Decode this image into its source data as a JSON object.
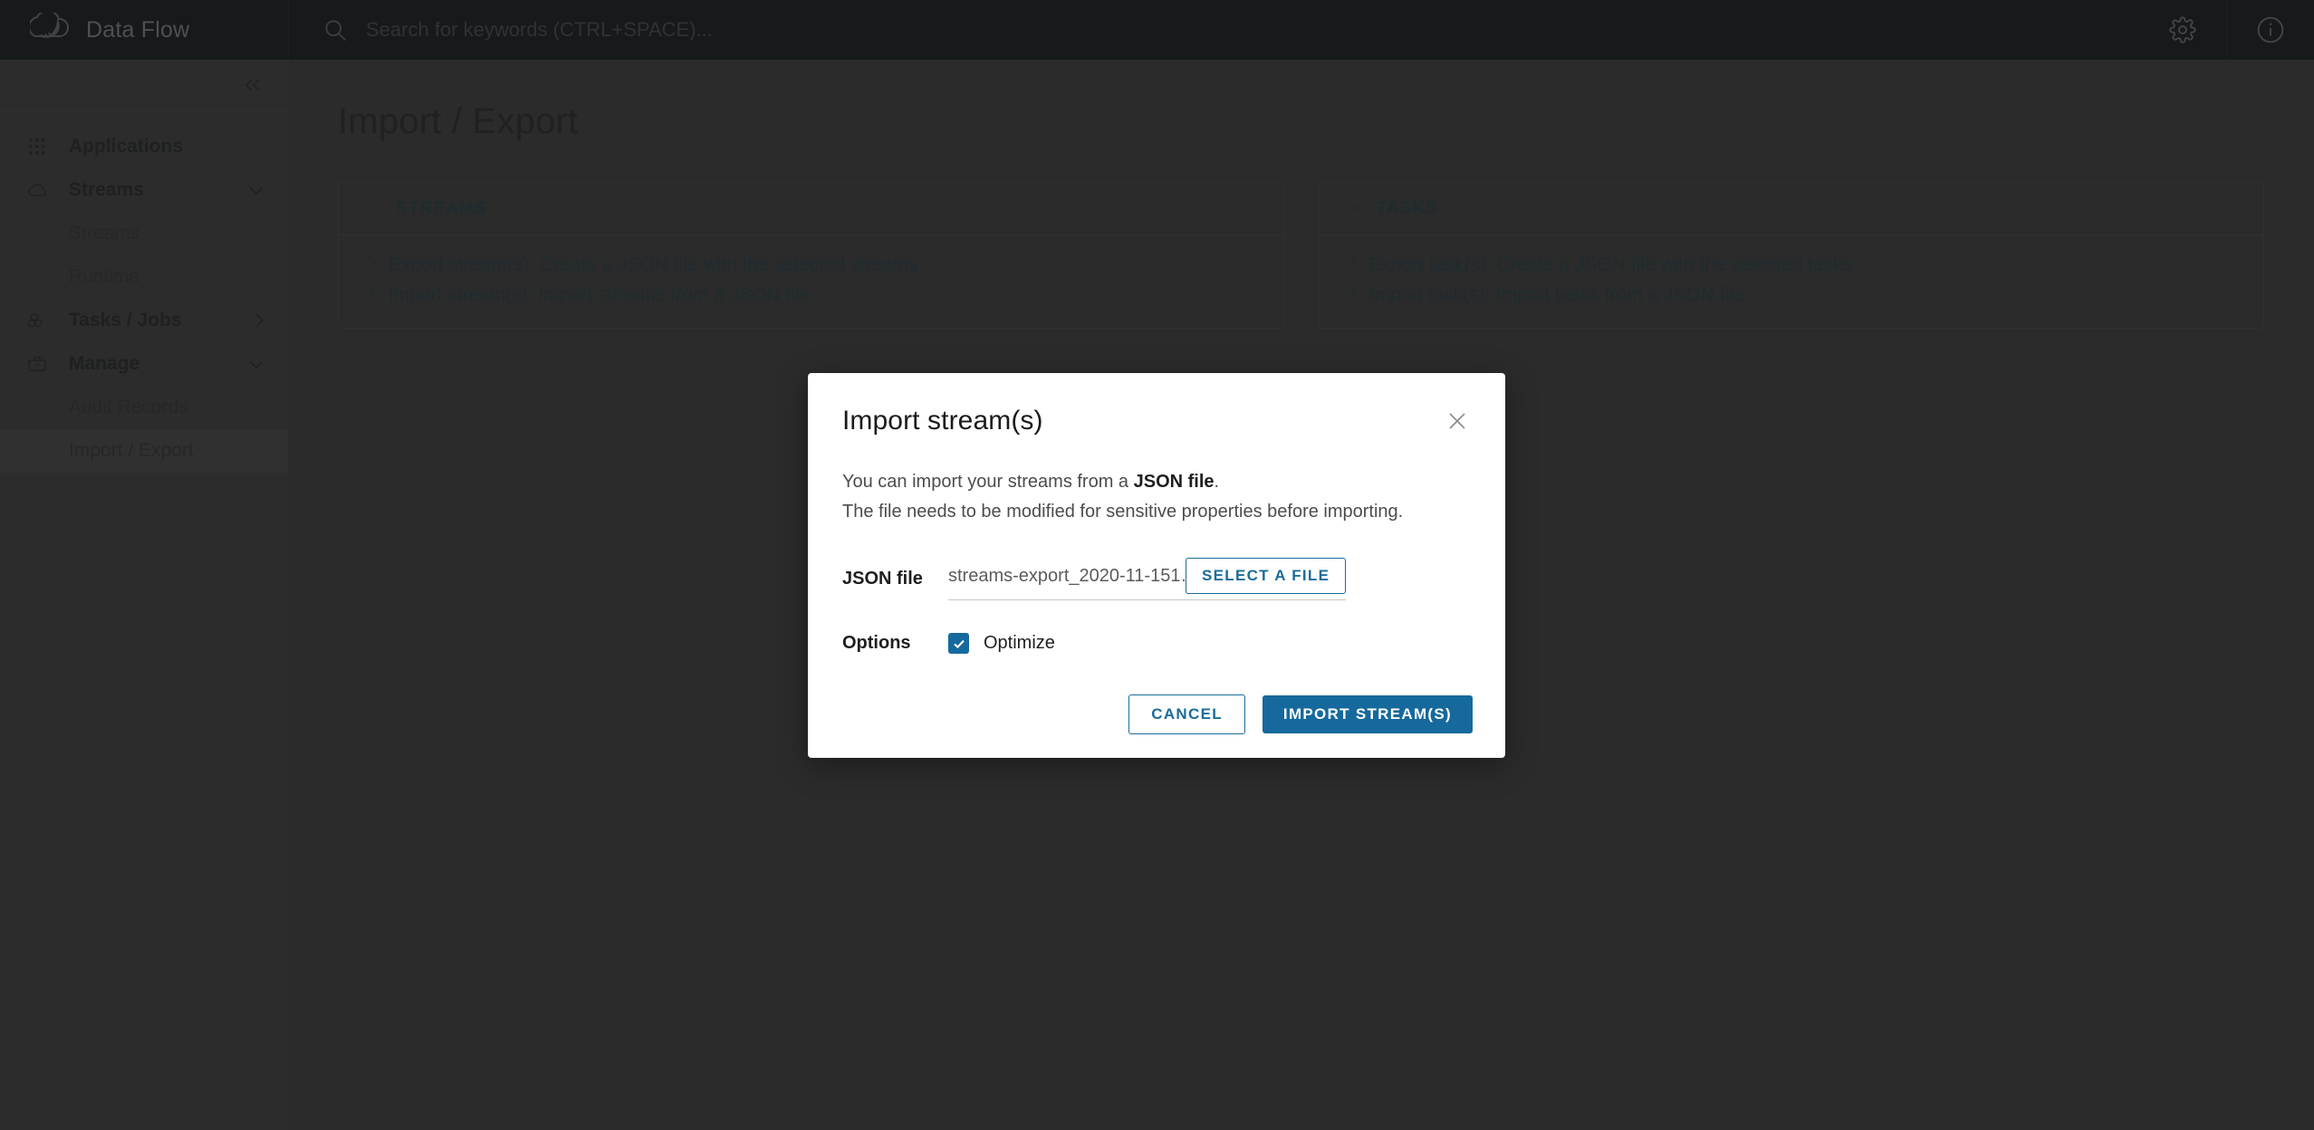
{
  "header": {
    "brand_title": "Data Flow",
    "logo_icon": "spring-cloud-leaf-logo",
    "search": {
      "icon": "search-icon",
      "placeholder": "Search for keywords (CTRL+SPACE)...",
      "value": ""
    },
    "settings_icon": "gear-icon",
    "about_icon": "info-circle-icon"
  },
  "sidebar": {
    "collapse_icon": "double-chevron-left-icon",
    "items": [
      {
        "label": "Applications",
        "icon": "grid-apps-icon",
        "type": "group",
        "chevron": "none",
        "active": false
      },
      {
        "label": "Streams",
        "icon": "cloud-icon",
        "type": "group",
        "chevron": "chevron-down-icon",
        "active": false
      },
      {
        "label": "Streams",
        "icon": "none",
        "type": "sub",
        "chevron": "none",
        "active": false
      },
      {
        "label": "Runtime",
        "icon": "none",
        "type": "sub",
        "chevron": "none",
        "active": false
      },
      {
        "label": "Tasks / Jobs",
        "icon": "cubes-icon",
        "type": "group",
        "chevron": "chevron-right-icon",
        "active": false
      },
      {
        "label": "Manage",
        "icon": "briefcase-icon",
        "type": "group",
        "chevron": "chevron-down-icon",
        "active": false
      },
      {
        "label": "Audit Records",
        "icon": "none",
        "type": "sub",
        "chevron": "none",
        "active": false
      },
      {
        "label": "Import / Export",
        "icon": "none",
        "type": "sub",
        "chevron": "none",
        "active": true
      }
    ]
  },
  "main": {
    "page_title": "Import / Export",
    "cards": [
      {
        "title": "STREAMS",
        "chevron": "chevron-down-icon",
        "links": [
          {
            "label": "Export stream(s): Create a JSON file with the selected streams",
            "chevron": "chevron-right-icon"
          },
          {
            "label": "Import stream(s): Import streams from a JSON file",
            "chevron": "chevron-right-icon"
          }
        ]
      },
      {
        "title": "TASKS",
        "chevron": "chevron-down-icon",
        "links": [
          {
            "label": "Export task(s): Create a JSON file with the selected tasks",
            "chevron": "chevron-right-icon"
          },
          {
            "label": "Import task(s): Import tasks from a JSON file",
            "chevron": "chevron-right-icon"
          }
        ]
      }
    ]
  },
  "modal": {
    "title": "Import stream(s)",
    "close_icon": "close-x-icon",
    "paragraph1_pre": "You can import your streams from a ",
    "paragraph1_bold": "JSON file",
    "paragraph1_post": ".",
    "paragraph2": "The file needs to be modified for sensitive properties before importing.",
    "file_label": "JSON file",
    "file_name": "streams-export_2020-11-151…",
    "select_file_label": "SELECT A FILE",
    "options_label": "Options",
    "optimize_label": "Optimize",
    "optimize_checked": true,
    "checkbox_icon": "check-icon",
    "cancel_label": "CANCEL",
    "submit_label": "IMPORT STREAM(S)"
  },
  "colors": {
    "accent_blue": "#16699c",
    "header_bg": "#2f3437",
    "sidebar_bg": "#585858",
    "main_bg": "#565656",
    "link_text": "#3f565f"
  }
}
